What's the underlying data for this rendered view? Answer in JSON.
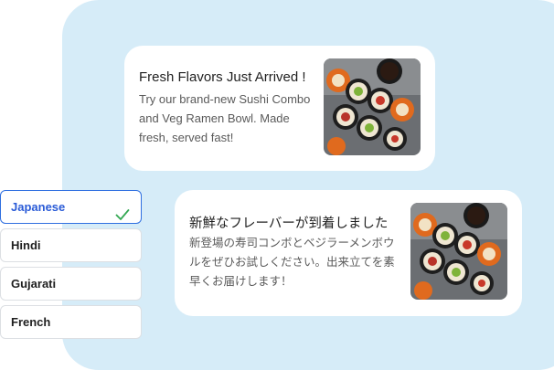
{
  "notifications": {
    "english": {
      "title": "Fresh Flavors Just Arrived !",
      "body": "Try our brand-new Sushi Combo and Veg Ramen Bowl. Made fresh, served fast!",
      "image_alt": "sushi-rolls-photo"
    },
    "japanese": {
      "title": "新鮮なフレーバーが到着しました",
      "body": "新登場の寿司コンボとベジラーメンボウルをぜひお試しください。出来立てを素早くお届けします！",
      "image_alt": "sushi-rolls-photo"
    }
  },
  "languages": {
    "items": [
      {
        "label": "Japanese",
        "selected": true
      },
      {
        "label": "Hindi",
        "selected": false
      },
      {
        "label": "Gujarati",
        "selected": false
      },
      {
        "label": "French",
        "selected": false
      }
    ]
  },
  "colors": {
    "panel_bg": "#d6ecf8",
    "accent_blue": "#2a5bd7",
    "check_green": "#34a853"
  },
  "icons": {
    "selected_check": "check-icon"
  }
}
